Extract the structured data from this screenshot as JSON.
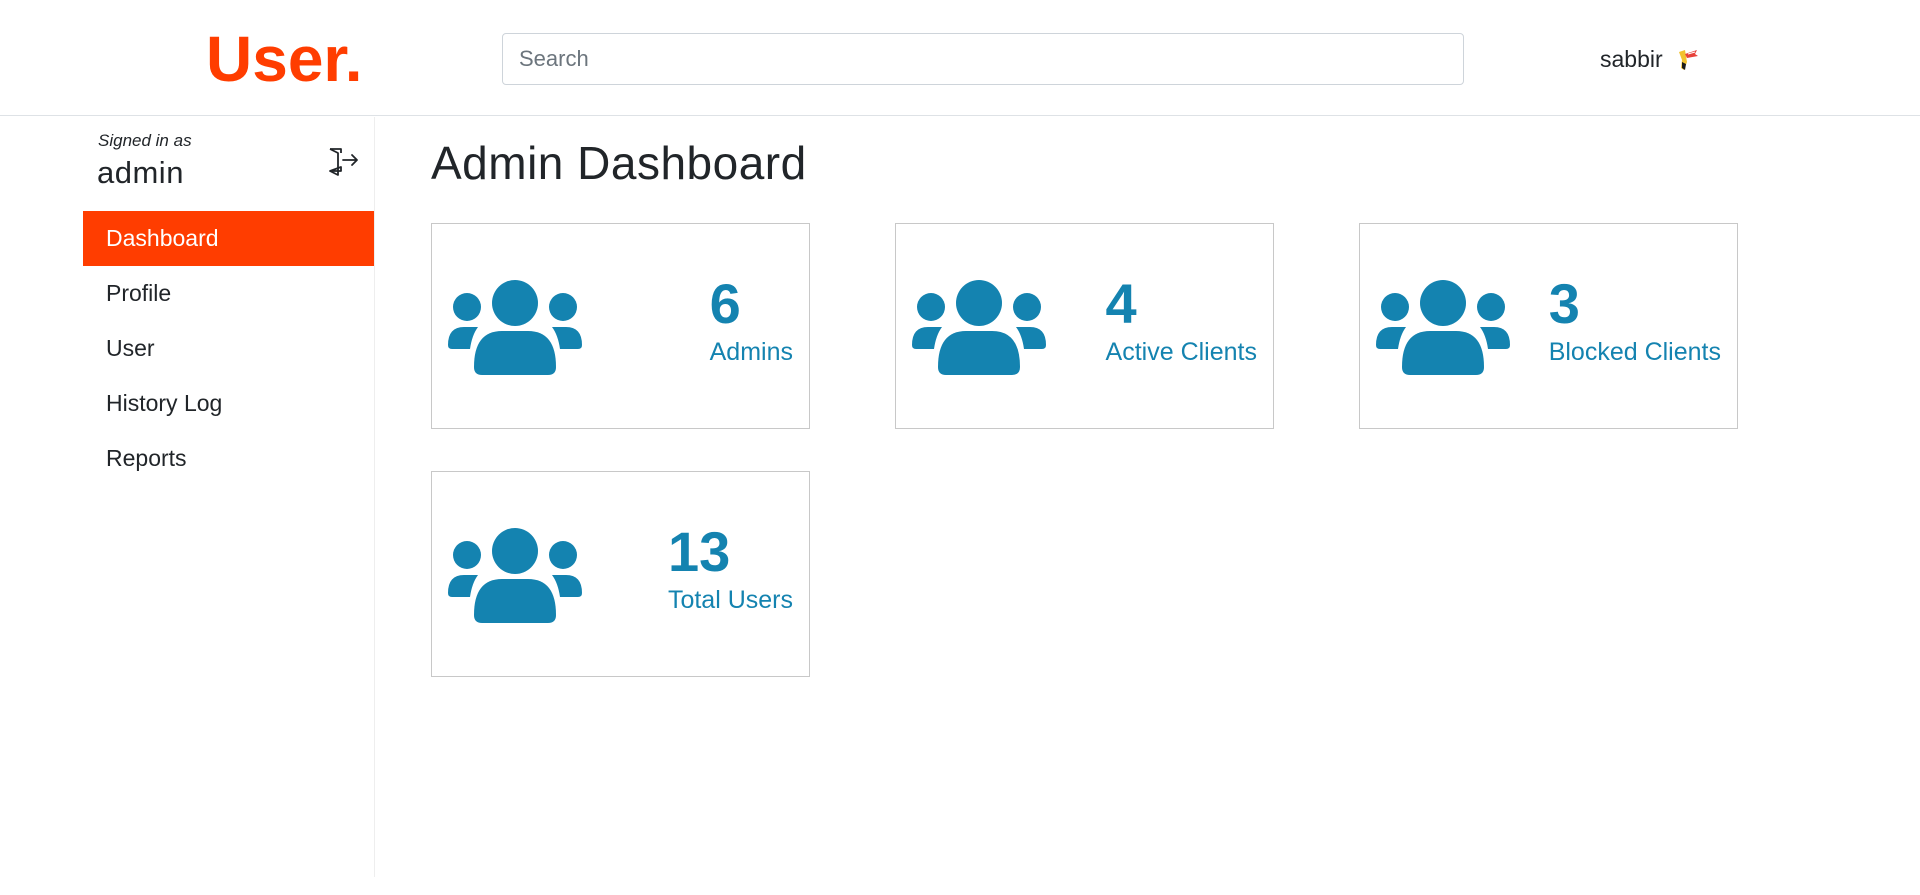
{
  "header": {
    "brand": "User.",
    "search_placeholder": "Search",
    "username": "sabbir"
  },
  "sidebar": {
    "signed_in_label": "Signed in as",
    "signed_in_user": "admin",
    "items": [
      {
        "label": "Dashboard",
        "active": true
      },
      {
        "label": "Profile",
        "active": false
      },
      {
        "label": "User",
        "active": false
      },
      {
        "label": "History Log",
        "active": false
      },
      {
        "label": "Reports",
        "active": false
      }
    ]
  },
  "main": {
    "title": "Admin Dashboard",
    "cards": [
      {
        "value": "6",
        "label": "Admins",
        "icon": "users-icon"
      },
      {
        "value": "4",
        "label": "Active Clients",
        "icon": "users-icon"
      },
      {
        "value": "3",
        "label": "Blocked Clients",
        "icon": "users-icon"
      },
      {
        "value": "13",
        "label": "Total Users",
        "icon": "users-icon"
      }
    ]
  },
  "colors": {
    "brand": "#ff3d00",
    "accent": "#1483b0",
    "nav_active_bg": "#ff3d00"
  }
}
